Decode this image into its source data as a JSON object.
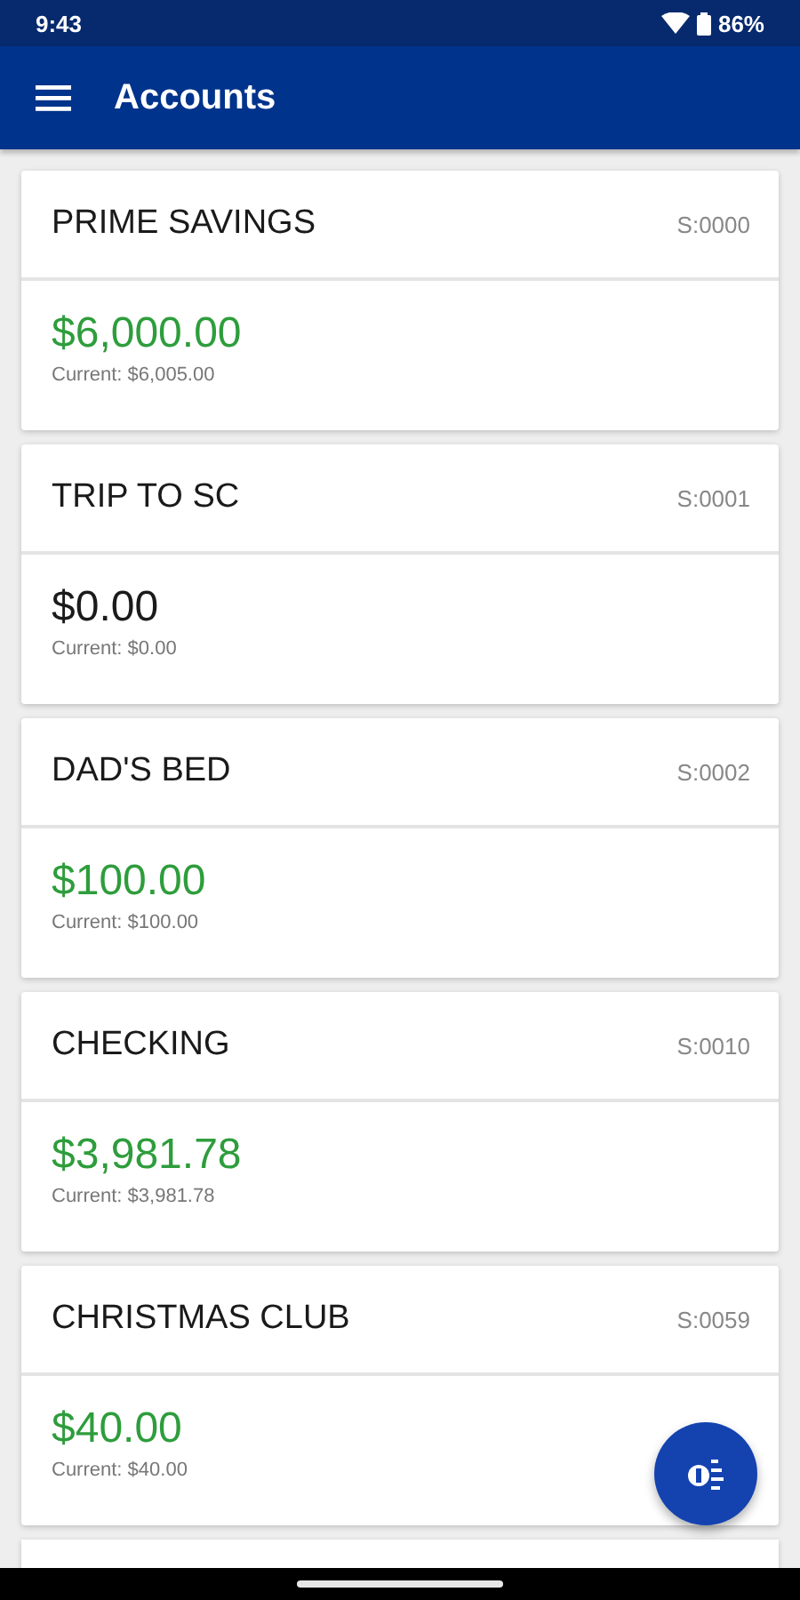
{
  "status_bar": {
    "time": "9:43",
    "battery": "86%"
  },
  "app_bar": {
    "title": "Accounts"
  },
  "accounts": [
    {
      "name": "PRIME SAVINGS",
      "code": "S:0000",
      "balance": "$6,000.00",
      "current": "Current: $6,005.00",
      "color": "#2e9d3c"
    },
    {
      "name": "TRIP TO SC",
      "code": "S:0001",
      "balance": "$0.00",
      "current": "Current: $0.00",
      "color": "#1b1b1b"
    },
    {
      "name": "DAD'S BED",
      "code": "S:0002",
      "balance": "$100.00",
      "current": "Current: $100.00",
      "color": "#2e9d3c"
    },
    {
      "name": "CHECKING",
      "code": "S:0010",
      "balance": "$3,981.78",
      "current": "Current: $3,981.78",
      "color": "#2e9d3c"
    },
    {
      "name": "CHRISTMAS CLUB",
      "code": "S:0059",
      "balance": "$40.00",
      "current": "Current: $40.00",
      "color": "#2e9d3c"
    }
  ]
}
